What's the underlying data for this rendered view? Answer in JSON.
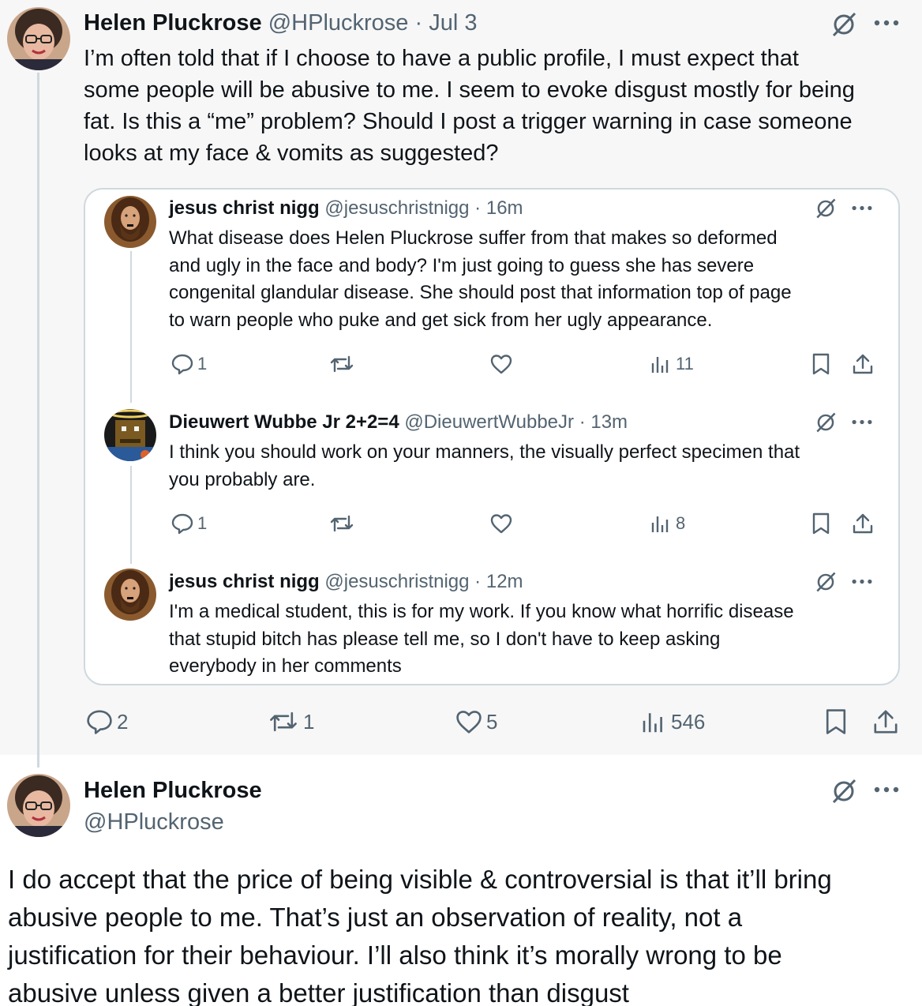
{
  "main_post": {
    "name": "Helen Pluckrose",
    "handle": "@HPluckrose",
    "separator": "·",
    "date": "Jul 3",
    "lines": [
      "I’m often told that if I choose to have a public profile, I must expect that",
      "some people will be abusive to me. I seem to evoke disgust mostly for being",
      "fat. Is this a “me” problem? Should I post a trigger warning in case someone",
      "looks at my face & vomits as suggested?"
    ],
    "replies": "2",
    "reposts": "1",
    "likes": "5",
    "views": "546"
  },
  "quoted": [
    {
      "name": "jesus christ nigg",
      "handle": "@jesuschristnigg",
      "separator": "·",
      "time": "16m",
      "lines": [
        "What disease does Helen Pluckrose suffer from that makes so deformed",
        "and ugly in the face and body? I'm just going to guess she has severe",
        "congenital glandular disease. She should post that information top of page",
        "to warn people who puke and get sick from her ugly appearance."
      ],
      "replies": "1",
      "views": "11"
    },
    {
      "name": "Dieuwert Wubbe Jr 2+2=4",
      "handle": "@DieuwertWubbeJr",
      "separator": "·",
      "time": "13m",
      "lines": [
        "I think you should work on your manners, the visually perfect specimen that",
        "you probably are."
      ],
      "replies": "1",
      "views": "8"
    },
    {
      "name": "jesus christ nigg",
      "handle": "@jesuschristnigg",
      "separator": "·",
      "time": "12m",
      "lines": [
        "I'm a medical student, this is for my work. If you know what horrific disease",
        "that stupid bitch has please tell me, so I don't have to keep asking",
        "everybody in her comments"
      ]
    }
  ],
  "followup_post": {
    "name": "Helen Pluckrose",
    "handle": "@HPluckrose",
    "lines": [
      "I do accept that the price of being visible & controversial is that it’ll bring",
      "abusive people to me. That’s just an observation of reality, not a",
      "justification for their behaviour. I’ll also think it’s morally wrong to be",
      "abusive unless given a better justification than disgust"
    ]
  },
  "icons": {
    "grok": "grok-icon",
    "more": "more-icon",
    "reply": "reply-icon",
    "repost": "repost-icon",
    "like": "like-icon",
    "views": "views-icon",
    "bookmark": "bookmark-icon",
    "share": "share-icon"
  },
  "colors": {
    "text": "#0f1419",
    "secondary": "#536471",
    "border": "#cfd9de",
    "thread_bg": "#f7f7f7"
  }
}
